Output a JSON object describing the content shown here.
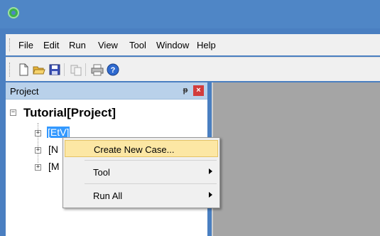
{
  "menubar": {
    "items": [
      {
        "label": "File"
      },
      {
        "label": "Edit"
      },
      {
        "label": "Run"
      },
      {
        "label": "View"
      },
      {
        "label": "Tool"
      },
      {
        "label": "Window"
      },
      {
        "label": "Help"
      }
    ]
  },
  "toolbar": {
    "buttons": [
      {
        "icon": "new-document-icon"
      },
      {
        "icon": "open-folder-icon"
      },
      {
        "icon": "save-icon"
      },
      {
        "icon": "copy-icon"
      },
      {
        "icon": "print-icon"
      },
      {
        "icon": "help-icon"
      }
    ]
  },
  "project_panel": {
    "title": "Project",
    "tree": {
      "root": {
        "label": "Tutorial[Project]"
      },
      "children": [
        {
          "label": "[EtV]",
          "selected": true
        },
        {
          "label": "[N"
        },
        {
          "label": "[M"
        }
      ]
    }
  },
  "context_menu": {
    "items": [
      {
        "label": "Create New Case...",
        "highlighted": true,
        "submenu": false
      },
      {
        "label": "Tool",
        "submenu": true
      },
      {
        "label": "Run All",
        "submenu": true
      }
    ]
  },
  "colors": {
    "titlebar": "#4f86c6",
    "selection": "#3399ff",
    "menu_highlight": "#fce7a4",
    "workspace": "#a5a5a5"
  }
}
